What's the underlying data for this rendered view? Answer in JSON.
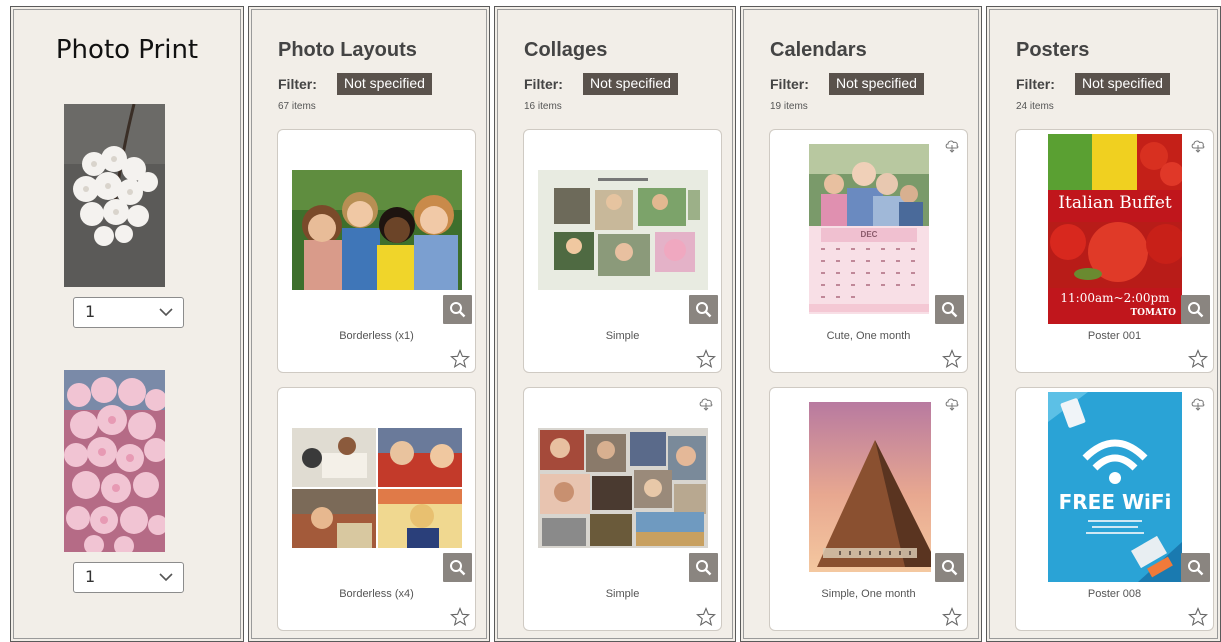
{
  "photo_print": {
    "title": "Photo Print",
    "photos": [
      {
        "subject": "white cherry blossom",
        "quantity": "1"
      },
      {
        "subject": "pink cherry blossom",
        "quantity": "1"
      }
    ]
  },
  "categories": [
    {
      "title": "Photo Layouts",
      "filter_label": "Filter:",
      "filter_value": "Not specified",
      "count": "67 items",
      "cards": [
        {
          "label": "Borderless (x1)",
          "cloud": false
        },
        {
          "label": "Borderless (x4)",
          "cloud": false
        }
      ]
    },
    {
      "title": "Collages",
      "filter_label": "Filter:",
      "filter_value": "Not specified",
      "count": "16 items",
      "cards": [
        {
          "label": "Simple",
          "cloud": false
        },
        {
          "label": "Simple",
          "cloud": true
        }
      ]
    },
    {
      "title": "Calendars",
      "filter_label": "Filter:",
      "filter_value": "Not specified",
      "count": "19 items",
      "cards": [
        {
          "label": "Cute, One month",
          "cloud": true,
          "calendar_month": "DEC"
        },
        {
          "label": "Simple, One month",
          "cloud": true
        }
      ]
    },
    {
      "title": "Posters",
      "filter_label": "Filter:",
      "filter_value": "Not specified",
      "count": "24 items",
      "cards": [
        {
          "label": "Poster 001",
          "cloud": true,
          "poster_title": "Italian Buffet",
          "poster_time": "11:00am~2:00pm",
          "poster_brand": "TOMATO"
        },
        {
          "label": "Poster 008",
          "cloud": true,
          "poster_title": "FREE WiFi"
        }
      ]
    }
  ],
  "icons": {
    "zoom": "magnifier-icon",
    "favorite": "star-outline-icon",
    "cloud": "cloud-download-icon",
    "dropdown": "chevron-down-icon"
  },
  "colors": {
    "panel_bg": "#f2eee8",
    "badge_bg": "#5a524c",
    "zoom_bg": "#8a8580",
    "poster_red": "#c0161c",
    "poster_wifi": "#2aa3d6"
  }
}
